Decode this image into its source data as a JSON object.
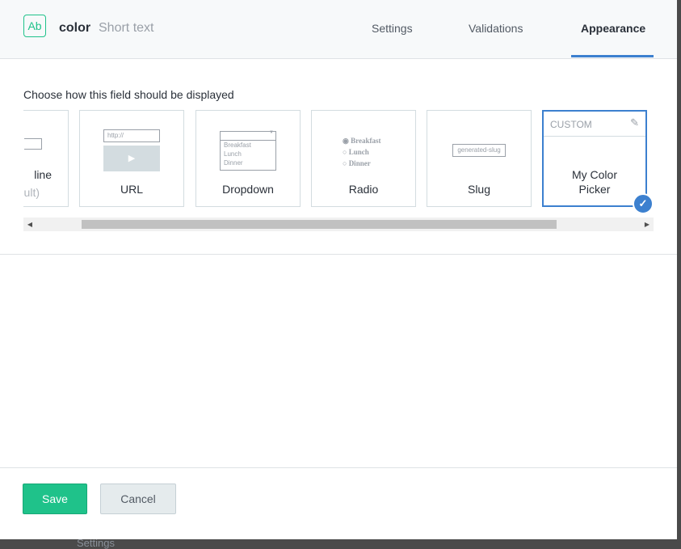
{
  "header": {
    "type_icon_text": "Ab",
    "field_name": "color",
    "field_type": "Short text",
    "tabs": [
      {
        "label": "Settings",
        "active": false
      },
      {
        "label": "Validations",
        "active": false
      },
      {
        "label": "Appearance",
        "active": true
      }
    ]
  },
  "appearance": {
    "prompt": "Choose how this field should be displayed",
    "cards": [
      {
        "label_line1": "line",
        "label_line2": "ult)"
      },
      {
        "label": "URL",
        "preview_text": "http://"
      },
      {
        "label": "Dropdown",
        "preview_options": [
          "Breakfast",
          "Lunch",
          "Dinner"
        ]
      },
      {
        "label": "Radio",
        "preview_options": [
          "Breakfast",
          "Lunch",
          "Dinner"
        ]
      },
      {
        "label": "Slug",
        "preview_text": "generated-slug"
      },
      {
        "label_line1": "My Color",
        "label_line2": "Picker",
        "tag": "CUSTOM",
        "selected": true
      }
    ]
  },
  "footer": {
    "save_label": "Save",
    "cancel_label": "Cancel"
  },
  "behind": {
    "text": "Settings"
  },
  "colors": {
    "accent": "#3c80cf",
    "save_green": "#1fc28a"
  }
}
